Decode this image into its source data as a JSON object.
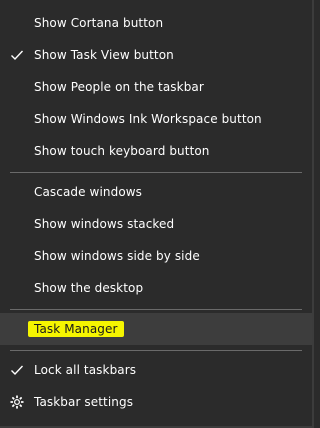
{
  "menu": {
    "items": [
      {
        "label": "Show Cortana button",
        "checked": false
      },
      {
        "label": "Show Task View button",
        "checked": true
      },
      {
        "label": "Show People on the taskbar",
        "checked": false
      },
      {
        "label": "Show Windows Ink Workspace button",
        "checked": false
      },
      {
        "label": "Show touch keyboard button",
        "checked": false
      },
      {
        "label": "Cascade windows",
        "checked": false
      },
      {
        "label": "Show windows stacked",
        "checked": false
      },
      {
        "label": "Show windows side by side",
        "checked": false
      },
      {
        "label": "Show the desktop",
        "checked": false
      },
      {
        "label": "Task Manager",
        "checked": false,
        "highlighted": true
      },
      {
        "label": "Lock all taskbars",
        "checked": true
      },
      {
        "label": "Taskbar settings",
        "icon": "gear-icon"
      }
    ]
  },
  "colors": {
    "background": "#2b2b2b",
    "text": "#ffffff",
    "separator": "#6a6a6a",
    "hover": "#3d3d3d",
    "highlight": "#f5f500"
  }
}
